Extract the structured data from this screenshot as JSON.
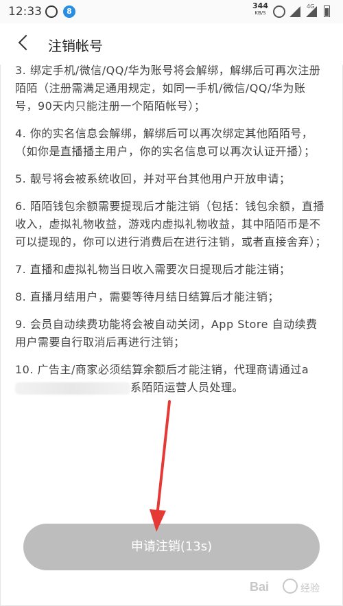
{
  "status_bar": {
    "time": "12:33",
    "net_speed_value": "344",
    "net_speed_unit": "KB/S",
    "network": "4G",
    "icons": [
      "qq-icon",
      "notification-icon",
      "alarm-icon",
      "signal-icon",
      "signal-icon",
      "battery-icon"
    ]
  },
  "header": {
    "title": "注销帐号"
  },
  "items": [
    "3. 绑定手机/微信/QQ/华为账号将会解绑，解绑后可再次注册陌陌（注册需满足通用规定，如同一手机/微信/QQ/华为账号，90天内只能注册一个陌陌帐号）；",
    "4. 你的实名信息会解绑，解绑后可以再次绑定其他陌陌号，（如你是直播播主用户，你的实名信息可以再次认证开播）；",
    "5. 靓号将会被系统收回，并对平台其他用户开放申请；",
    "6. 陌陌钱包余额需要提现后才能注销（包括：钱包余额，直播收入，虚拟礼物收益，游戏内虚拟礼物收益，其中陌陌币是不可以提现的，你可以进行消费后在进行注销，或者直接舍弃）；",
    "7. 直播和虚拟礼物当日收入需要次日提现后才能注销；",
    "8. 直播月结用户，需要等待月结日结算后才能注销；",
    "9. 会员自动续费功能将会被自动关闭，App Store 自动续费用户需要自行取消后再进行注销；"
  ],
  "item10": {
    "before": "10. 广告主/商家必须结算余额后才能注销，代理商请通过a",
    "after": "系陌陌运营人员处理。"
  },
  "button": {
    "label": "申请注销(13s)"
  },
  "watermark": {
    "text_latin": "Bai",
    "text_cn": "经验"
  },
  "colors": {
    "button_bg": "#bdbdbd",
    "arrow": "#e53935"
  }
}
